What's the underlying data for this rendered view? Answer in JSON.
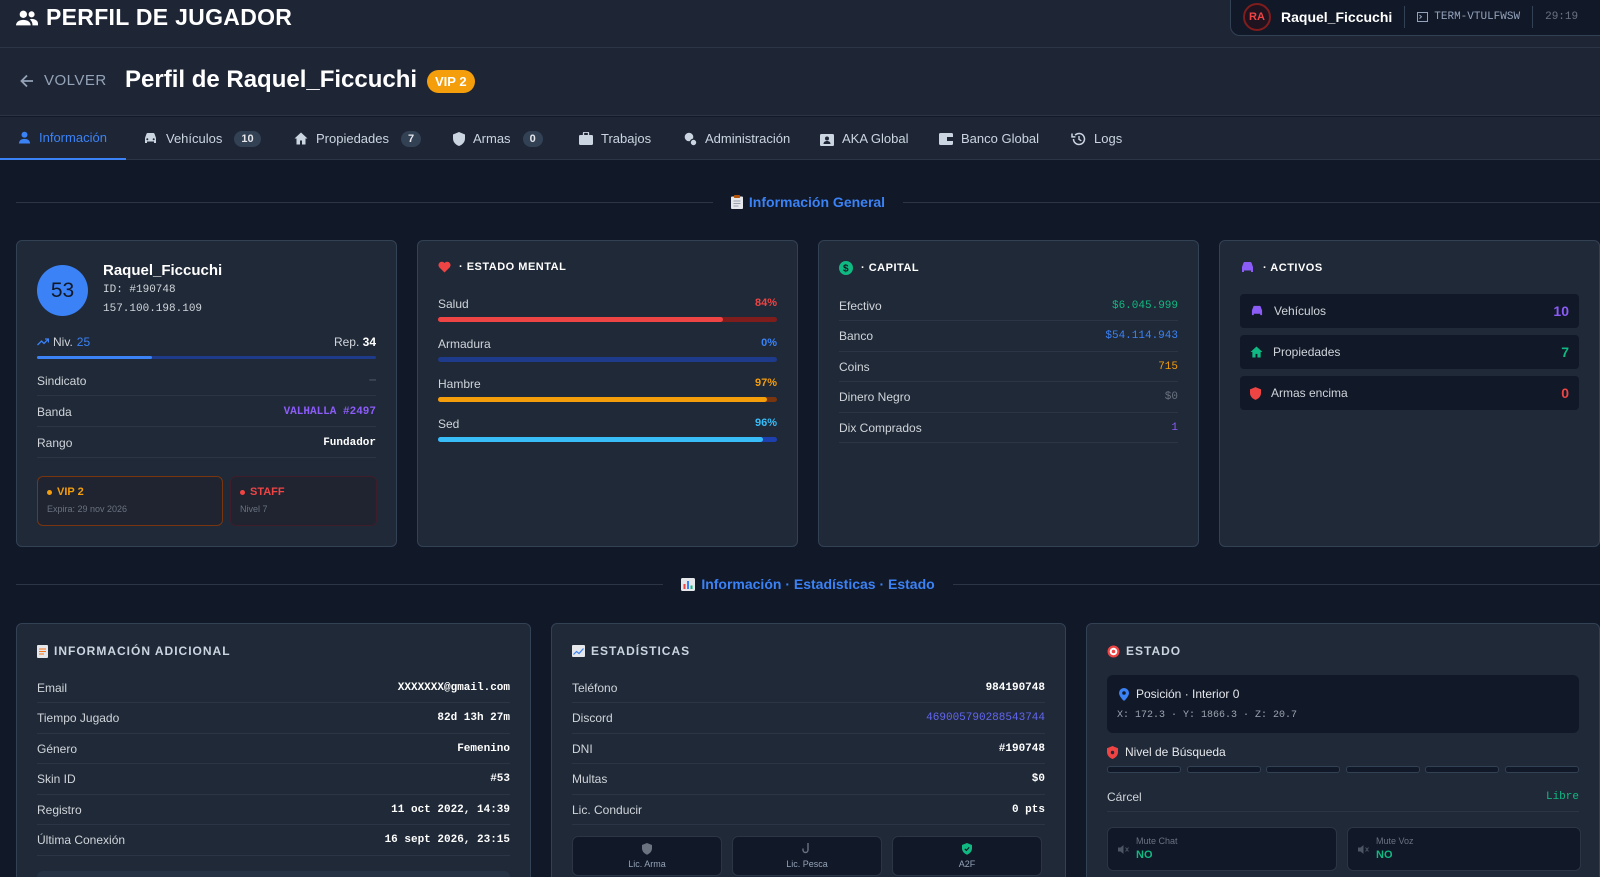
{
  "app": {
    "title": "PERFIL DE JUGADOR"
  },
  "user": {
    "initials": "RA",
    "name": "Raquel_Ficcuchi",
    "terminal": "TERM-VTULFWSW",
    "clock": "29:19"
  },
  "header": {
    "back_label": "VOLVER",
    "title": "Perfil de Raquel_Ficcuchi",
    "vip_badge": "VIP 2"
  },
  "tabs": [
    {
      "label": "Información",
      "icon": "user-icon"
    },
    {
      "label": "Vehículos",
      "icon": "car-icon",
      "count": "10"
    },
    {
      "label": "Propiedades",
      "icon": "home-icon",
      "count": "7"
    },
    {
      "label": "Armas",
      "icon": "shield-icon",
      "count": "0"
    },
    {
      "label": "Trabajos",
      "icon": "briefcase-icon"
    },
    {
      "label": "Administración",
      "icon": "admin-icon"
    },
    {
      "label": "AKA Global",
      "icon": "id-card-icon"
    },
    {
      "label": "Banco Global",
      "icon": "wallet-icon"
    },
    {
      "label": "Logs",
      "icon": "history-icon"
    }
  ],
  "sections": {
    "general": "Información General",
    "stats": "Información · Estadísticas · Estado"
  },
  "player_card": {
    "level_badge": "53",
    "name": "Raquel_Ficcuchi",
    "id": "ID: #190748",
    "ip": "157.100.198.109",
    "niv_label": "Niv.",
    "niv_value": "25",
    "rep_label": "Rep.",
    "rep_value": "34",
    "level_progress": 0.34,
    "rows": [
      {
        "k": "Sindicato",
        "v": "—",
        "color": "#4b5563"
      },
      {
        "k": "Banda",
        "v": "VALHALLA #2497",
        "color": "#8b5cf6"
      },
      {
        "k": "Rango",
        "v": "Fundador",
        "color": "#ffffff"
      }
    ],
    "vip": {
      "title": "VIP 2",
      "sub": "Expira: 29 nov 2026",
      "color": "#f59e0b"
    },
    "staff": {
      "title": "STAFF",
      "sub": "Nivel 7",
      "color": "#ef4444"
    }
  },
  "mental": {
    "title": "· ESTADO MENTAL",
    "bars": [
      {
        "label": "Salud",
        "pct_label": "84%",
        "value": 0.84,
        "color": "#ef4444",
        "track": "#7f1d1d"
      },
      {
        "label": "Armadura",
        "pct_label": "0%",
        "value": 0.0,
        "color": "#3b82f6",
        "track": "#1e3a8a"
      },
      {
        "label": "Hambre",
        "pct_label": "97%",
        "value": 0.97,
        "color": "#f59e0b",
        "track": "#78350f"
      },
      {
        "label": "Sed",
        "pct_label": "96%",
        "value": 0.96,
        "color": "#38bdf8",
        "track": "#1e40af"
      }
    ]
  },
  "capital": {
    "title": "· CAPITAL",
    "rows": [
      {
        "k": "Efectivo",
        "v": "$6.045.999",
        "color": "#10b981"
      },
      {
        "k": "Banco",
        "v": "$54.114.943",
        "color": "#3b82f6"
      },
      {
        "k": "Coins",
        "v": "715",
        "color": "#f59e0b"
      },
      {
        "k": "Dinero Negro",
        "v": "$0",
        "color": "#6b7280"
      },
      {
        "k": "Dix Comprados",
        "v": "1",
        "color": "#8b5cf6"
      }
    ]
  },
  "activos": {
    "title": "· ACTIVOS",
    "items": [
      {
        "label": "Vehículos",
        "count": "10",
        "color": "#8b5cf6"
      },
      {
        "label": "Propiedades",
        "count": "7",
        "color": "#10b981"
      },
      {
        "label": "Armas encima",
        "count": "0",
        "color": "#ef4444"
      }
    ]
  },
  "info_adicional": {
    "title": "INFORMACIÓN ADICIONAL",
    "rows": [
      {
        "k": "Email",
        "v": "XXXXXXX@gmail.com"
      },
      {
        "k": "Tiempo Jugado",
        "v": "82d 13h 27m"
      },
      {
        "k": "Género",
        "v": "Femenino"
      },
      {
        "k": "Skin ID",
        "v": "#53"
      },
      {
        "k": "Registro",
        "v": "11 oct 2022, 14:39"
      },
      {
        "k": "Última Conexión",
        "v": "16 sept 2026, 23:15"
      }
    ]
  },
  "estadisticas": {
    "title": "ESTADÍSTICAS",
    "rows": [
      {
        "k": "Teléfono",
        "v": "984190748",
        "color": "#ffffff"
      },
      {
        "k": "Discord",
        "v": "469005790288543744",
        "color": "#6366f1"
      },
      {
        "k": "DNI",
        "v": "#190748",
        "color": "#ffffff"
      },
      {
        "k": "Multas",
        "v": "$0",
        "color": "#ffffff"
      },
      {
        "k": "Lic. Conducir",
        "v": "0 pts",
        "color": "#ffffff"
      }
    ],
    "licenses": [
      {
        "label": "Lic. Arma",
        "icon": "shield-icon",
        "color": "#6b7280"
      },
      {
        "label": "Lic. Pesca",
        "icon": "hook-icon",
        "color": "#6b7280"
      },
      {
        "label": "A2F",
        "icon": "shield-check-icon",
        "color": "#10b981"
      }
    ]
  },
  "estado": {
    "title": "ESTADO",
    "position_label": "Posición · Interior 0",
    "coords": "X: 172.3 · Y: 1866.3 · Z: 20.7",
    "wanted_label": "Nivel de Búsqueda",
    "wanted_level": 0,
    "carcel_label": "Cárcel",
    "carcel_value": "Libre",
    "mute_chat_label": "Mute Chat",
    "mute_chat_value": "NO",
    "mute_voz_label": "Mute Voz",
    "mute_voz_value": "NO"
  }
}
